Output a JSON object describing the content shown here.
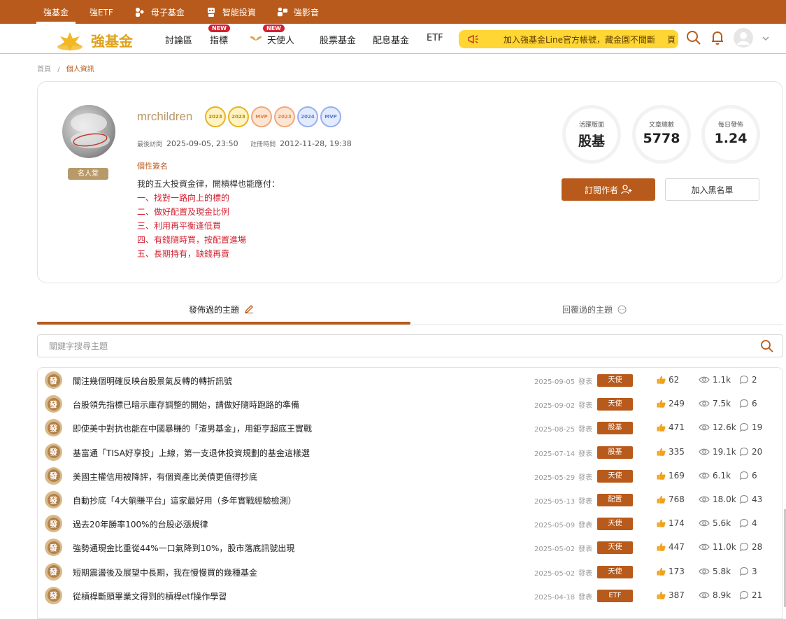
{
  "topbar": {
    "items": [
      {
        "label": "強基金",
        "active": true
      },
      {
        "label": "強ETF"
      },
      {
        "label": "母子基金"
      },
      {
        "label": "智能投資"
      },
      {
        "label": "強影音"
      }
    ]
  },
  "navbar": {
    "logo_text": "強基金",
    "links": [
      {
        "label": "討論區"
      },
      {
        "label": "指標",
        "badge": "NEW"
      },
      {
        "label": "天使人",
        "badge": "NEW"
      },
      {
        "label": "股票基金"
      },
      {
        "label": "配息基金"
      },
      {
        "label": "ETF"
      }
    ],
    "banner": "加入強基金Line官方帳號，藏金園不間斷",
    "banner_tail": "頁"
  },
  "breadcrumb": {
    "home": "首頁",
    "separator": "/",
    "current": "個人資訊"
  },
  "profile": {
    "username": "mrchildren",
    "fame_badge": "名人堂",
    "medals": [
      "2023",
      "2023",
      "MVP",
      "2023",
      "2024",
      "MVP"
    ],
    "last_visit_label": "最後訪問",
    "last_visit": "2025-09-05, 23:50",
    "register_label": "註冊時間",
    "register": "2012-11-28, 19:38",
    "signature_label": "個性簽名",
    "signature": [
      "我的五大投資金律，開槓桿也能應付：",
      "一、找對一路向上的標的",
      "二、做好配置及現金比例",
      "三、利用再平衡逢低買",
      "四、有錢隨時買，按配置進場",
      "五、長期持有，缺錢再賣"
    ],
    "stats": [
      {
        "label": "活躍版面",
        "value": "股基"
      },
      {
        "label": "文章總數",
        "value": "5778"
      },
      {
        "label": "每日發佈",
        "value": "1.24"
      }
    ],
    "subscribe_label": "訂閱作者",
    "blacklist_label": "加入黑名單"
  },
  "tabs": {
    "posted": "發佈過的主題",
    "replied": "回覆過的主題"
  },
  "search": {
    "placeholder": "關鍵字搜尋主題"
  },
  "posts": [
    {
      "icon": "發",
      "title": "關注幾個明確反映台股景氣反轉的轉折訊號",
      "date": "2025-09-05",
      "pub": "發表",
      "tag": "天使",
      "likes": "62",
      "views": "1.1k",
      "comments": "2"
    },
    {
      "icon": "發",
      "title": "台股領先指標已暗示庫存調整的開始，請做好隨時跑路的準備",
      "date": "2025-09-02",
      "pub": "發表",
      "tag": "天使",
      "likes": "249",
      "views": "7.5k",
      "comments": "6"
    },
    {
      "icon": "發",
      "title": "即使美中對抗也能在中國暴賺的「渣男基金」，用鉅亨超底王實戰",
      "date": "2025-08-25",
      "pub": "發表",
      "tag": "股基",
      "likes": "471",
      "views": "12.6k",
      "comments": "19"
    },
    {
      "icon": "發",
      "title": "基富通「TISA好享投」上線，第一支退休投資規劃的基金這樣選",
      "date": "2025-07-14",
      "pub": "發表",
      "tag": "股基",
      "likes": "335",
      "views": "19.1k",
      "comments": "20"
    },
    {
      "icon": "發",
      "title": "美國主權信用被降評，有個資產比美債更值得抄底",
      "date": "2025-05-29",
      "pub": "發表",
      "tag": "天使",
      "likes": "169",
      "views": "6.1k",
      "comments": "6"
    },
    {
      "icon": "發",
      "title": "自動抄底「4大躺賺平台」這家最好用（多年實戰經驗檢測）",
      "date": "2025-05-13",
      "pub": "發表",
      "tag": "配置",
      "likes": "768",
      "views": "18.0k",
      "comments": "43"
    },
    {
      "icon": "發",
      "title": "過去20年勝率100%的台股必漲規律",
      "date": "2025-05-09",
      "pub": "發表",
      "tag": "天使",
      "likes": "174",
      "views": "5.6k",
      "comments": "4"
    },
    {
      "icon": "發",
      "title": "強勢通現金比重從44%一口氣降到10%，股市落底訊號出現",
      "date": "2025-05-02",
      "pub": "發表",
      "tag": "天使",
      "likes": "447",
      "views": "11.0k",
      "comments": "28"
    },
    {
      "icon": "發",
      "title": "短期震盪後及展望中長期，我在慢慢買的幾種基金",
      "date": "2025-05-02",
      "pub": "發表",
      "tag": "天使",
      "likes": "173",
      "views": "5.8k",
      "comments": "3"
    },
    {
      "icon": "發",
      "title": "從槓桿斷頭畢業文得到的槓桿etf操作學習",
      "date": "2025-04-18",
      "pub": "發表",
      "tag": "ETF",
      "likes": "387",
      "views": "8.9k",
      "comments": "21"
    }
  ],
  "colors": {
    "brand": "#b85a1b",
    "accent_gold": "#b89a6a",
    "banner": "#ffd633",
    "signature_red": "#d3202f"
  }
}
